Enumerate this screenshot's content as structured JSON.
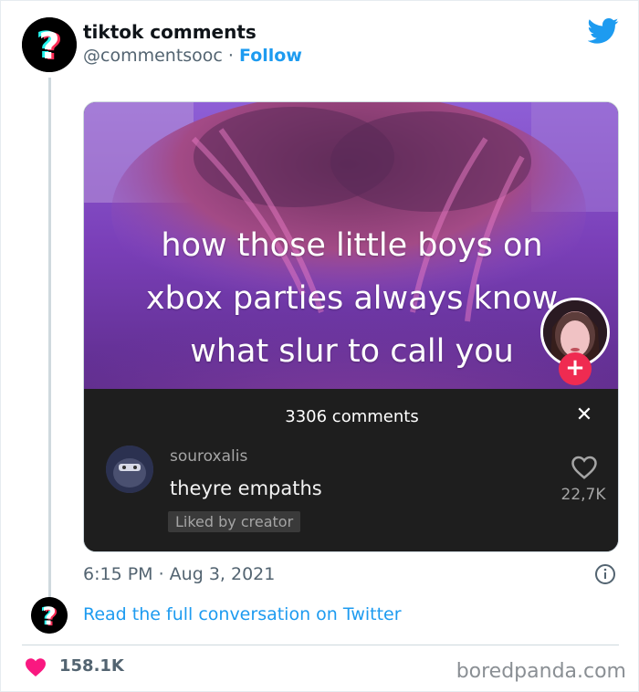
{
  "tweet": {
    "author_name": "tiktok comments",
    "handle": "@commentsooc",
    "separator": " · ",
    "follow_label": "Follow",
    "timestamp": "6:15 PM · Aug 3, 2021",
    "read_more_label": "Read the full conversation on Twitter",
    "likes": "158.1K"
  },
  "tiktok": {
    "caption_lines": [
      "how those little boys on",
      "xbox parties always know",
      "what slur to call you"
    ],
    "follow_plus": "+",
    "comments_header": "3306 comments",
    "close_glyph": "✕",
    "comment": {
      "username": "souroxalis",
      "text": "theyre empaths",
      "badge": "Liked by creator",
      "like_count": "22,7K"
    }
  },
  "watermark": "boredpanda.com",
  "colors": {
    "twitter_blue": "#1d9bf0",
    "like_pink": "#f91880",
    "tiktok_red": "#ef2b51",
    "panel_bg": "#1e1e1e"
  },
  "icons": [
    "twitter-bird-icon",
    "question-mark-logo-icon",
    "info-icon",
    "heart-icon",
    "heart-outline-icon",
    "close-icon"
  ]
}
